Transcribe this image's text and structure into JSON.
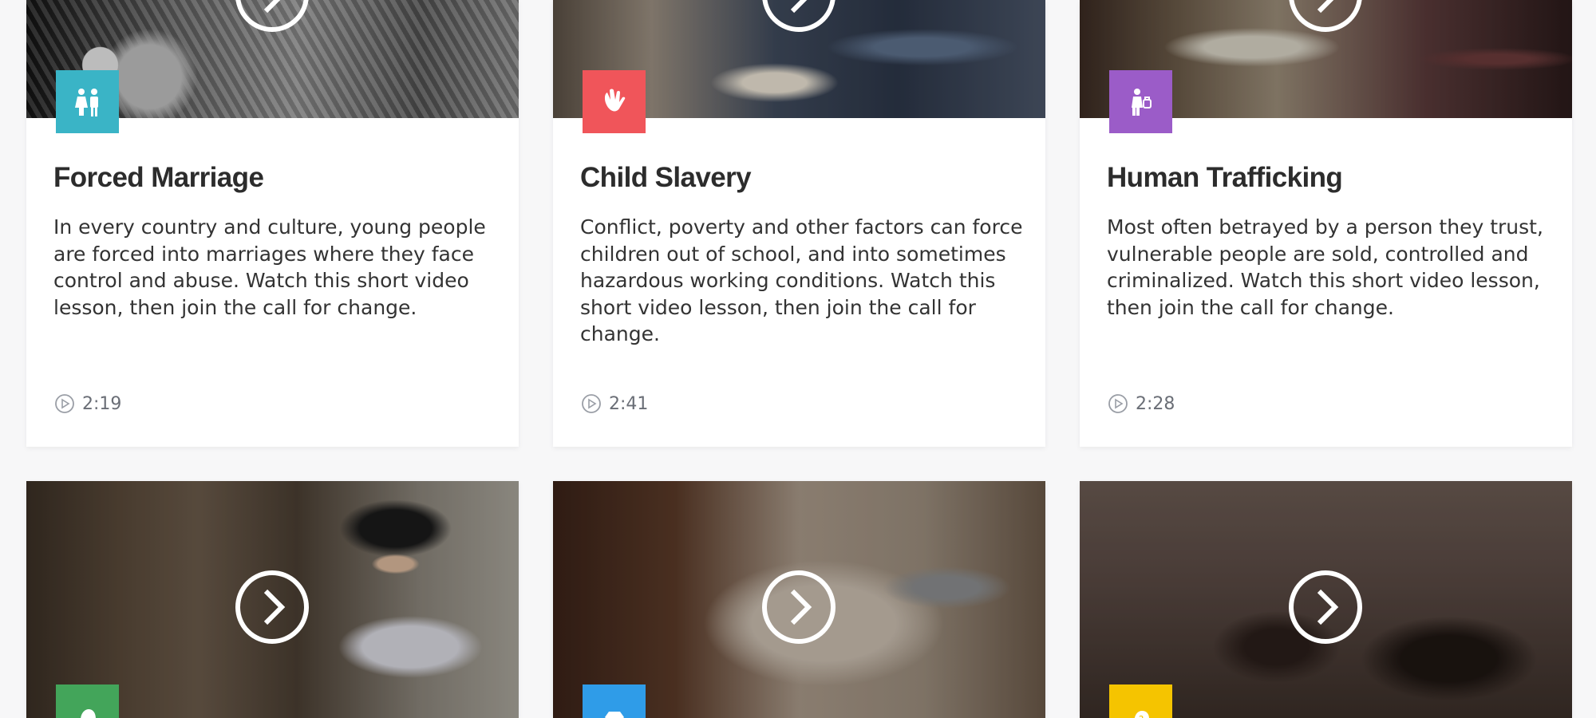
{
  "colors": {
    "forced_marriage": "#3ab4c6",
    "child_slavery": "#f0555a",
    "human_trafficking": "#9b5cc8",
    "green": "#43a55a",
    "blue": "#2f9ce8",
    "yellow": "#f5c400"
  },
  "cards_top": [
    {
      "title": "Forced Marriage",
      "description": "In every country and culture, young people are forced into marriages where they face control and abuse. Watch this short video lesson, then join the call for change.",
      "duration": "2:19",
      "badge_icon": "couple-icon"
    },
    {
      "title": "Child Slavery",
      "description": "Conflict, poverty and other factors can force children out of school, and into sometimes hazardous working conditions. Watch this short video lesson, then join the call for change.",
      "duration": "2:41",
      "badge_icon": "hand-icon"
    },
    {
      "title": "Human Trafficking",
      "description": "Most often betrayed by a person they trust, vulnerable people are sold, controlled and criminalized. Watch this short video lesson, then join the call for change.",
      "duration": "2:28",
      "badge_icon": "person-bag-icon"
    }
  ],
  "cards_bottom": [
    {
      "badge_icon": "head-icon"
    },
    {
      "badge_icon": "diamond-icon"
    },
    {
      "badge_icon": "question-head-icon"
    }
  ]
}
